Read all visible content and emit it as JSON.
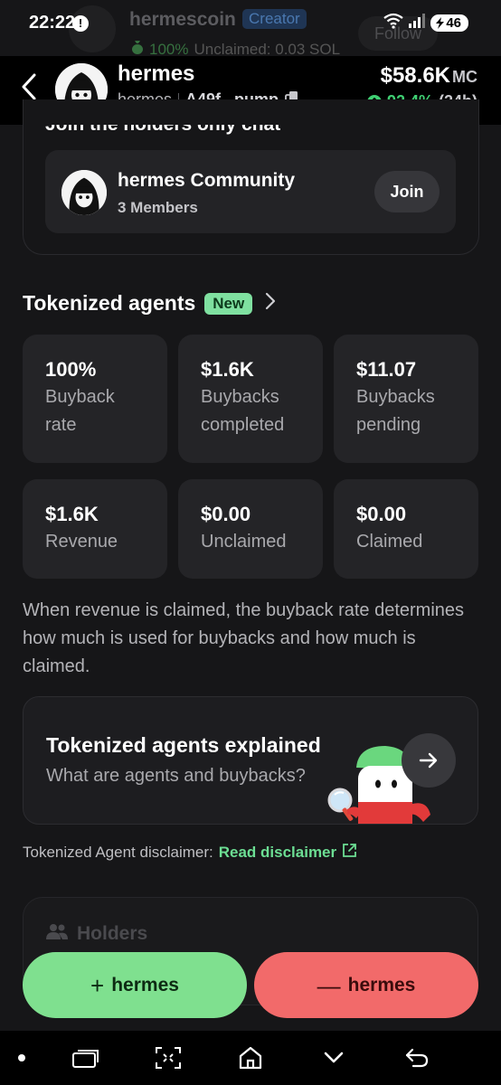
{
  "status_bar": {
    "time": "22:22",
    "battery": "46"
  },
  "underlying": {
    "name": "hermescoin",
    "badge": "Creator",
    "unclaimed_pct": "100%",
    "unclaimed_text": "Unclaimed: 0.03 SOL",
    "follow": "Follow"
  },
  "header": {
    "name": "hermes",
    "ticker": "hermes",
    "address": "A49f...pump",
    "market_cap": "$58.6K",
    "mc_unit": "MC",
    "change_pct": "92.4%",
    "change_period": "(24h)"
  },
  "community": {
    "section_title": "Join the holders only chat",
    "name": "hermes Community",
    "members": "3 Members",
    "join_label": "Join"
  },
  "tokenized": {
    "title": "Tokenized agents",
    "badge": "New",
    "stats": [
      {
        "value": "100%",
        "label": "Buyback rate"
      },
      {
        "value": "$1.6K",
        "label": "Buybacks completed"
      },
      {
        "value": "$11.07",
        "label": "Buybacks pending"
      },
      {
        "value": "$1.6K",
        "label": "Revenue"
      },
      {
        "value": "$0.00",
        "label": "Unclaimed"
      },
      {
        "value": "$0.00",
        "label": "Claimed"
      }
    ],
    "description": "When revenue is claimed, the buyback rate determines how much is used for buybacks and how much is claimed."
  },
  "explained": {
    "title": "Tokenized agents explained",
    "subtitle": "What are agents and buybacks?"
  },
  "disclaimer": {
    "text": "Tokenized Agent disclaimer:",
    "link": "Read disclaimer"
  },
  "holders": {
    "label": "Holders"
  },
  "actions": {
    "buy_label": "hermes",
    "sell_label": "hermes"
  },
  "colors": {
    "buy": "#7fe08f",
    "sell": "#f26a6a",
    "positive": "#3fcf72",
    "badge_new": "#7fe0a0",
    "creator_badge": "#1f3554"
  }
}
